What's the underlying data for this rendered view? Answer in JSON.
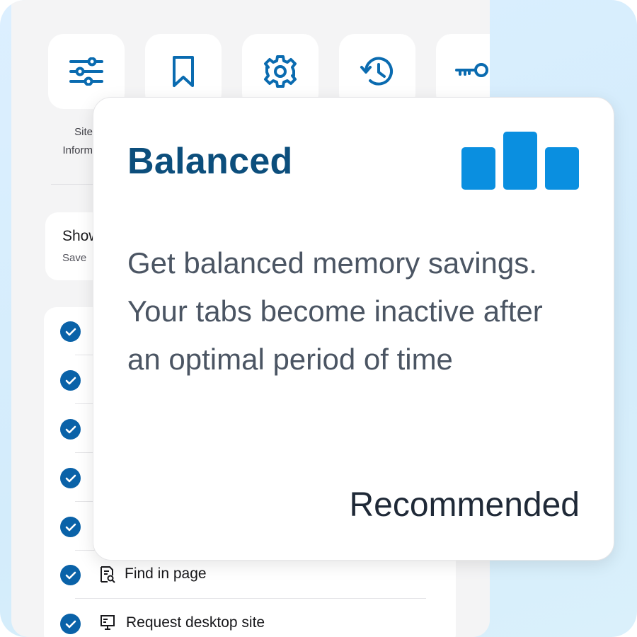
{
  "background_panel": {
    "tiles": [
      {
        "icon": "sliders-icon"
      },
      {
        "icon": "bookmark-icon"
      },
      {
        "icon": "gear-icon"
      },
      {
        "icon": "history-icon"
      },
      {
        "icon": "key-icon"
      }
    ],
    "tile_label_line1": "Site",
    "tile_label_line2": "Inform",
    "show_card": {
      "title": "Show",
      "subtitle": "Save"
    },
    "list_items": [
      {
        "label": ""
      },
      {
        "label": ""
      },
      {
        "label": ""
      },
      {
        "label": ""
      },
      {
        "label": ""
      },
      {
        "label": "Find in page",
        "icon": "find-in-page-icon"
      },
      {
        "label": "Request desktop site",
        "icon": "desktop-icon"
      }
    ]
  },
  "popup": {
    "title": "Balanced",
    "icon": "bar-level-icon",
    "description": "Get balanced memory savings. Your tabs become inactive after an optimal period of time",
    "badge": "Recommended"
  },
  "colors": {
    "accent": "#0a62a8",
    "title": "#0c4e7c",
    "bars": "#0a8fe0",
    "icon_blue": "#0a6bb0"
  }
}
